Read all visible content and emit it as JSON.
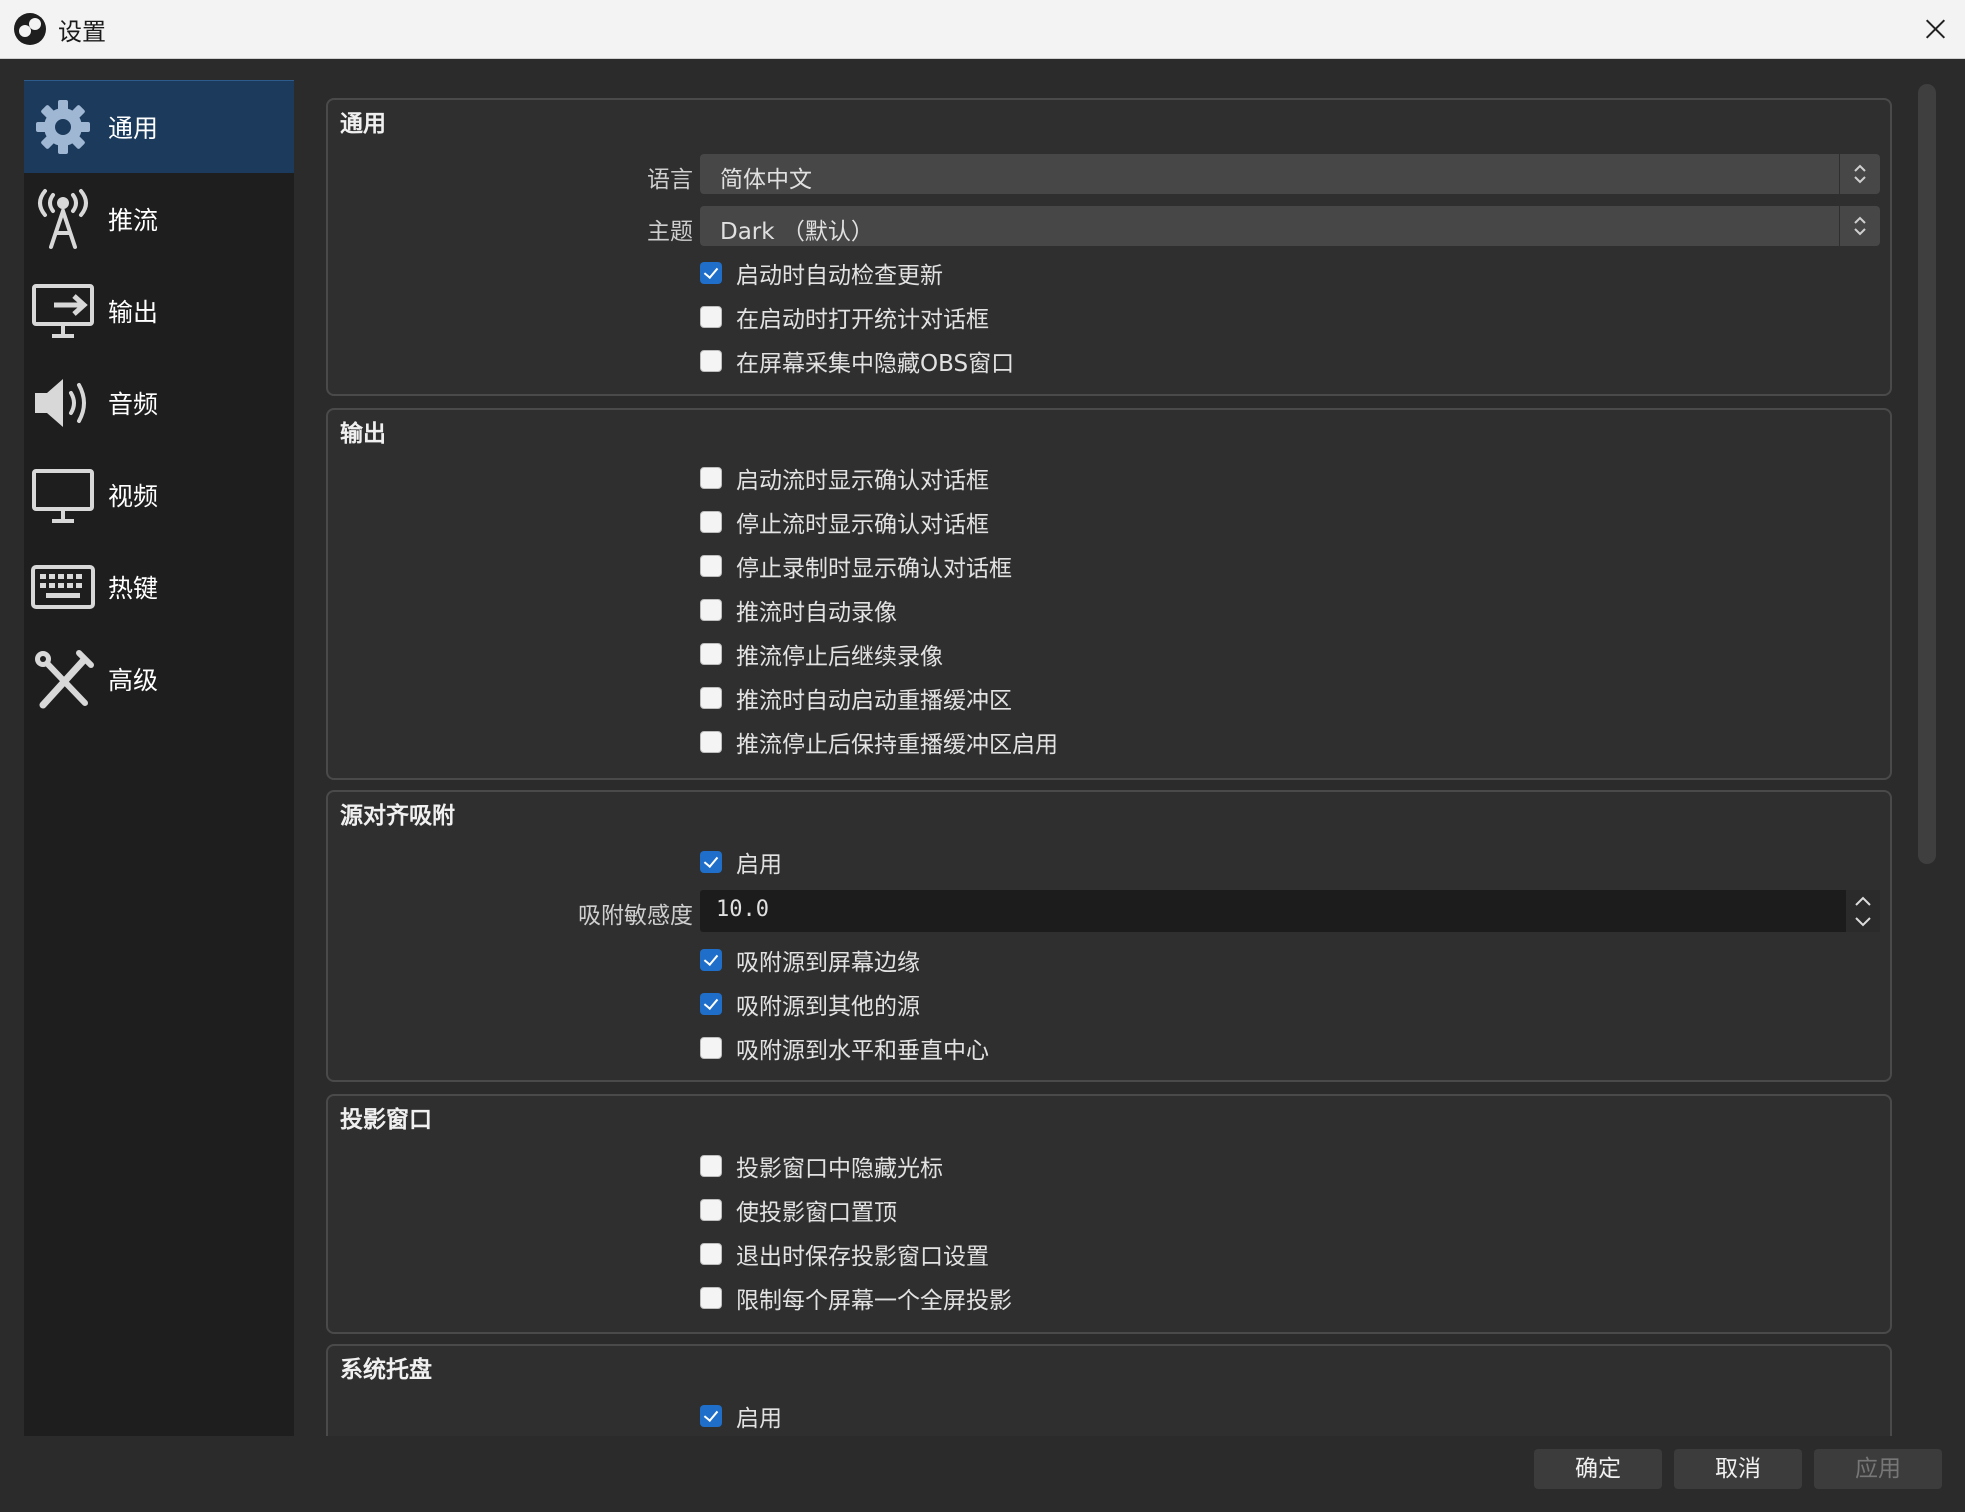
{
  "window": {
    "title": "设置"
  },
  "sidebar": {
    "items": [
      {
        "label": "通用",
        "icon": "gear-icon",
        "active": true
      },
      {
        "label": "推流",
        "icon": "antenna-icon"
      },
      {
        "label": "输出",
        "icon": "output-icon"
      },
      {
        "label": "音频",
        "icon": "speaker-icon"
      },
      {
        "label": "视频",
        "icon": "monitor-icon"
      },
      {
        "label": "热键",
        "icon": "keyboard-icon"
      },
      {
        "label": "高级",
        "icon": "tools-icon"
      }
    ]
  },
  "general": {
    "title": "通用",
    "language_label": "语言",
    "language_value": "简体中文",
    "theme_label": "主题",
    "theme_value": "Dark （默认）",
    "checkboxes": [
      {
        "label": "启动时自动检查更新",
        "checked": true
      },
      {
        "label": "在启动时打开统计对话框",
        "checked": false
      },
      {
        "label": "在屏幕采集中隐藏OBS窗口",
        "checked": false
      }
    ]
  },
  "output": {
    "title": "输出",
    "checkboxes": [
      {
        "label": "启动流时显示确认对话框",
        "checked": false
      },
      {
        "label": "停止流时显示确认对话框",
        "checked": false
      },
      {
        "label": "停止录制时显示确认对话框",
        "checked": false
      },
      {
        "label": "推流时自动录像",
        "checked": false
      },
      {
        "label": "推流停止后继续录像",
        "checked": false
      },
      {
        "label": "推流时自动启动重播缓冲区",
        "checked": false
      },
      {
        "label": "推流停止后保持重播缓冲区启用",
        "checked": false
      }
    ]
  },
  "snapping": {
    "title": "源对齐吸附",
    "enable_label": "启用",
    "enable_checked": true,
    "sensitivity_label": "吸附敏感度",
    "sensitivity_value": "10.0",
    "checkboxes": [
      {
        "label": "吸附源到屏幕边缘",
        "checked": true
      },
      {
        "label": "吸附源到其他的源",
        "checked": true
      },
      {
        "label": "吸附源到水平和垂直中心",
        "checked": false
      }
    ]
  },
  "projector": {
    "title": "投影窗口",
    "checkboxes": [
      {
        "label": "投影窗口中隐藏光标",
        "checked": false
      },
      {
        "label": "使投影窗口置顶",
        "checked": false
      },
      {
        "label": "退出时保存投影窗口设置",
        "checked": false
      },
      {
        "label": "限制每个屏幕一个全屏投影",
        "checked": false
      }
    ]
  },
  "tray": {
    "title": "系统托盘",
    "enable_label": "启用",
    "enable_checked": true
  },
  "buttons": {
    "ok": "确定",
    "cancel": "取消",
    "apply": "应用"
  },
  "colors": {
    "accent": "#1f6ec9",
    "active_nav": "#1b3a5c",
    "panel": "#2f2f2f"
  }
}
